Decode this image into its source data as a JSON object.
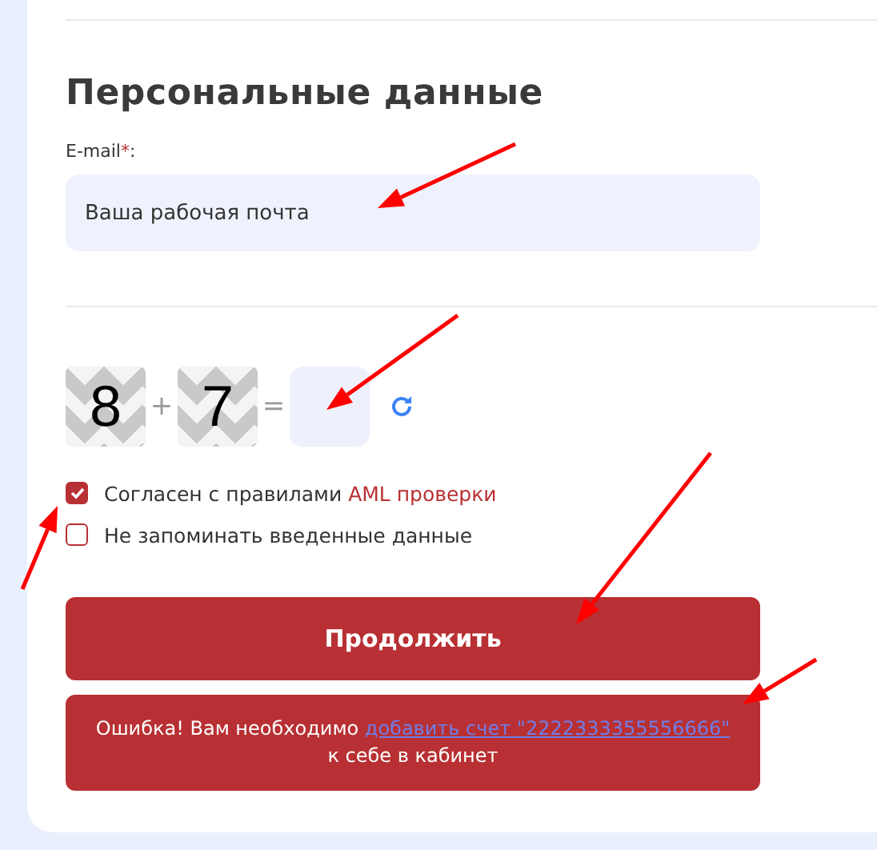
{
  "section": {
    "title": "Персональные данные"
  },
  "email": {
    "label": "E-mail",
    "required_mark": "*",
    "label_end": ":",
    "placeholder": "Ваша рабочая почта"
  },
  "captcha": {
    "first": "8",
    "operator": "+",
    "second": "7",
    "equals": "="
  },
  "checkboxes": [
    {
      "label": "Согласен с правилами ",
      "link": "AML проверки",
      "checked": true
    },
    {
      "label": "Не запоминать введенные данные",
      "checked": false
    }
  ],
  "submit": {
    "label": "Продолжить"
  },
  "error": {
    "text_before": "Ошибка! Вам необходимо ",
    "link": "добавить счет \"2222333355556666\"",
    "text_after": "к себе в кабинет"
  }
}
